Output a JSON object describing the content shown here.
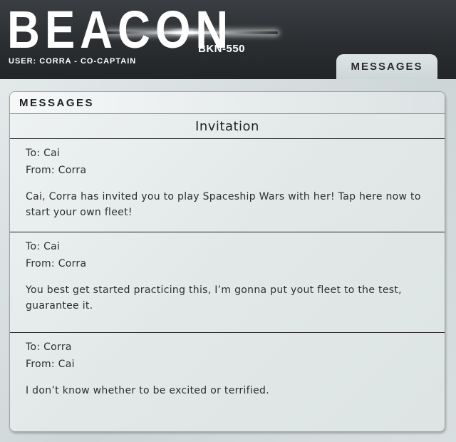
{
  "header": {
    "brand": "BEACON",
    "code": "BKN-550",
    "user_line": "USER: CORRA - CO-CAPTAIN"
  },
  "tabs": [
    {
      "label": "MESSAGES",
      "active": true
    }
  ],
  "panel": {
    "title": "MESSAGES",
    "sub_header": "Invitation"
  },
  "messages": [
    {
      "to": "To: Cai",
      "from": "From: Corra",
      "body": "Cai, Corra has invited you to play Spaceship Wars with her! Tap here now to start your own fleet!"
    },
    {
      "to": "To: Cai",
      "from": "From: Corra",
      "body": "You best get started practicing this, I’m gonna put yout fleet to the test, guarantee it."
    },
    {
      "to": "To: Corra",
      "from": "From: Cai",
      "body": "I don’t know whether to be excited or terrified."
    }
  ],
  "colors": {
    "header_bg": "#2b2e31",
    "panel_bg": "#e6ebeb",
    "text": "#2b2e30",
    "divider": "#1e1e1e"
  }
}
